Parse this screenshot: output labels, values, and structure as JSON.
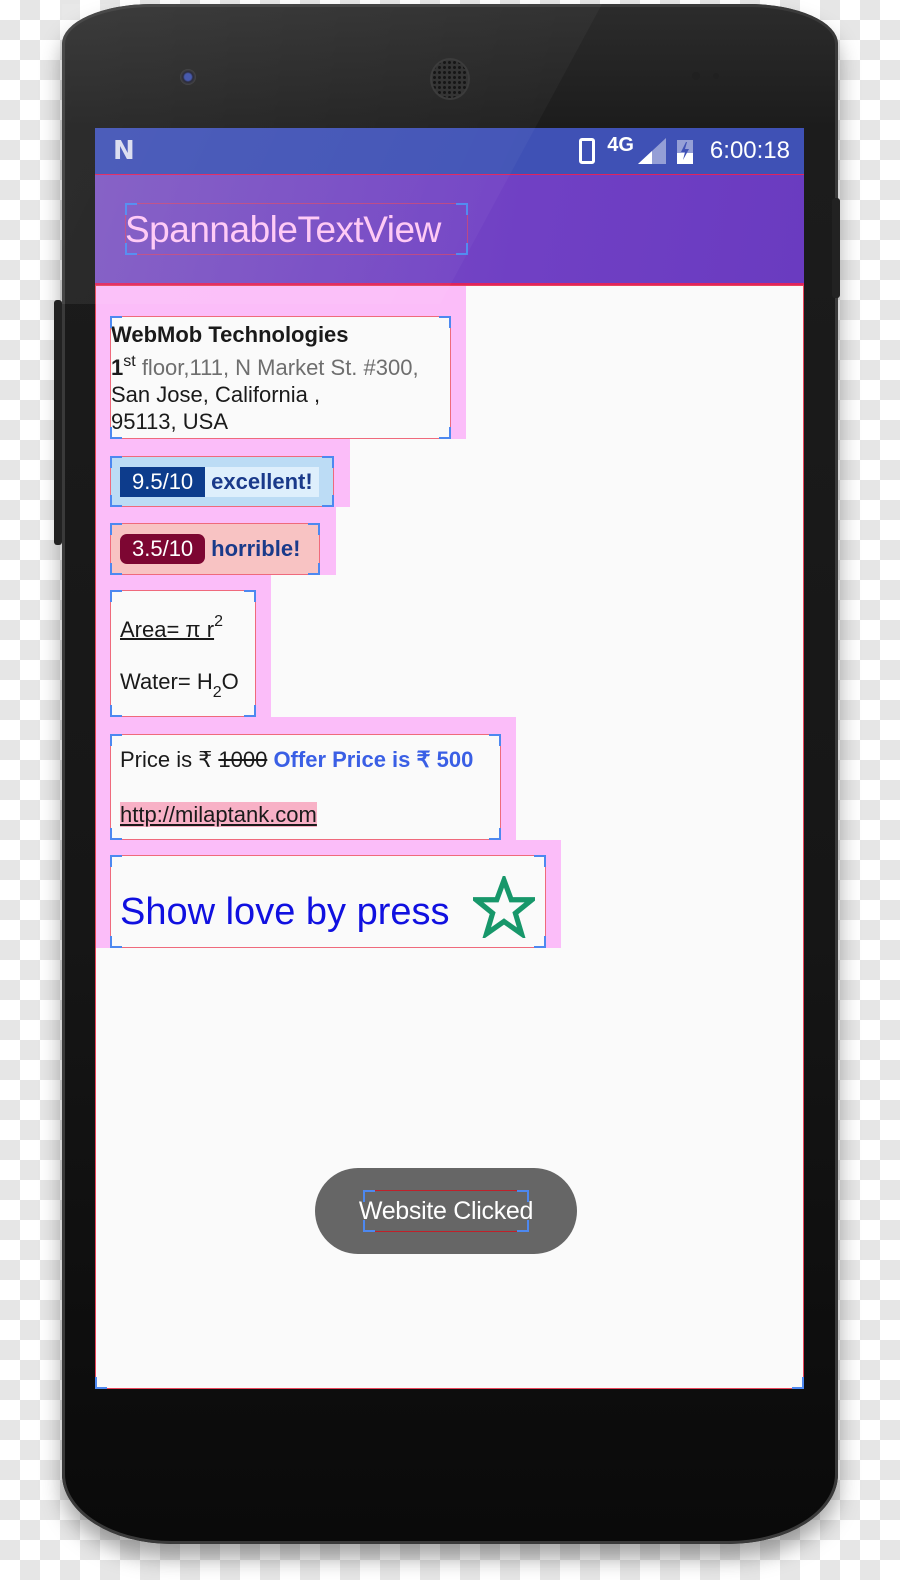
{
  "status_bar": {
    "notification_icon": "android-n-icon",
    "network_type": "4G",
    "time": "6:00:18",
    "icons": [
      "phone-icon",
      "signal-icon",
      "battery-charging-icon"
    ]
  },
  "app_bar": {
    "title": "SpannableTextView"
  },
  "address_card": {
    "company": "WebMob Technologies",
    "floor_number": "1",
    "floor_suffix": "st",
    "line1_rest": " floor,111, N Market St. #300,",
    "line2": "San Jose, California ,",
    "line3": "95113, USA"
  },
  "ratings": [
    {
      "score": "9.5/10",
      "label": "excellent!",
      "score_bg": "#0d3c8c",
      "bg": "#d4ebfb",
      "outer_bg": "#bcdcf5"
    },
    {
      "score": "3.5/10",
      "label": "horrible!",
      "score_bg": "#7d0632",
      "bg": "#f8c3c3",
      "outer_bg": "#f8c3c3"
    }
  ],
  "formulas": {
    "area_prefix": "Area= π r",
    "area_exponent": "2",
    "water_prefix": "Water= H",
    "water_subscript": "2",
    "water_suffix": "O"
  },
  "price_card": {
    "price_prefix": "Price is ₹ ",
    "old_price": "1000",
    "offer_text": "Offer Price is ₹ 500",
    "link": "http://milaptank.com"
  },
  "love_card": {
    "text": "Show love by press",
    "star_icon": "star-outline-icon",
    "star_color": "#17976a"
  },
  "toast": {
    "message": "Website Clicked"
  }
}
